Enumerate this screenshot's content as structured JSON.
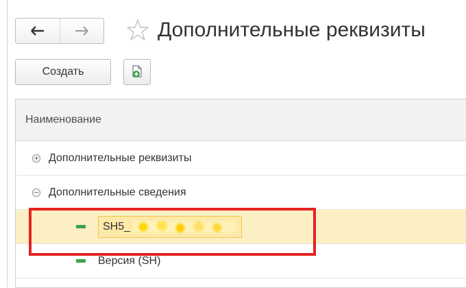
{
  "window": {
    "title": "Дополнительные реквизиты"
  },
  "toolbar": {
    "create_label": "Создать",
    "copy_icon": "copy-add-icon"
  },
  "table": {
    "column_header": "Наименование",
    "rows": [
      {
        "label": "Дополнительные реквизиты",
        "type": "group",
        "state": "collapsed"
      },
      {
        "label": "Дополнительные сведения",
        "type": "group",
        "state": "expanded"
      },
      {
        "label": "SH5_",
        "type": "item",
        "selected": true
      },
      {
        "label": "Версия (SH)",
        "type": "item",
        "selected": false
      }
    ]
  },
  "colors": {
    "selection": "#fcefc3",
    "highlight": "#e32222",
    "item_marker": "#3aa44a"
  }
}
